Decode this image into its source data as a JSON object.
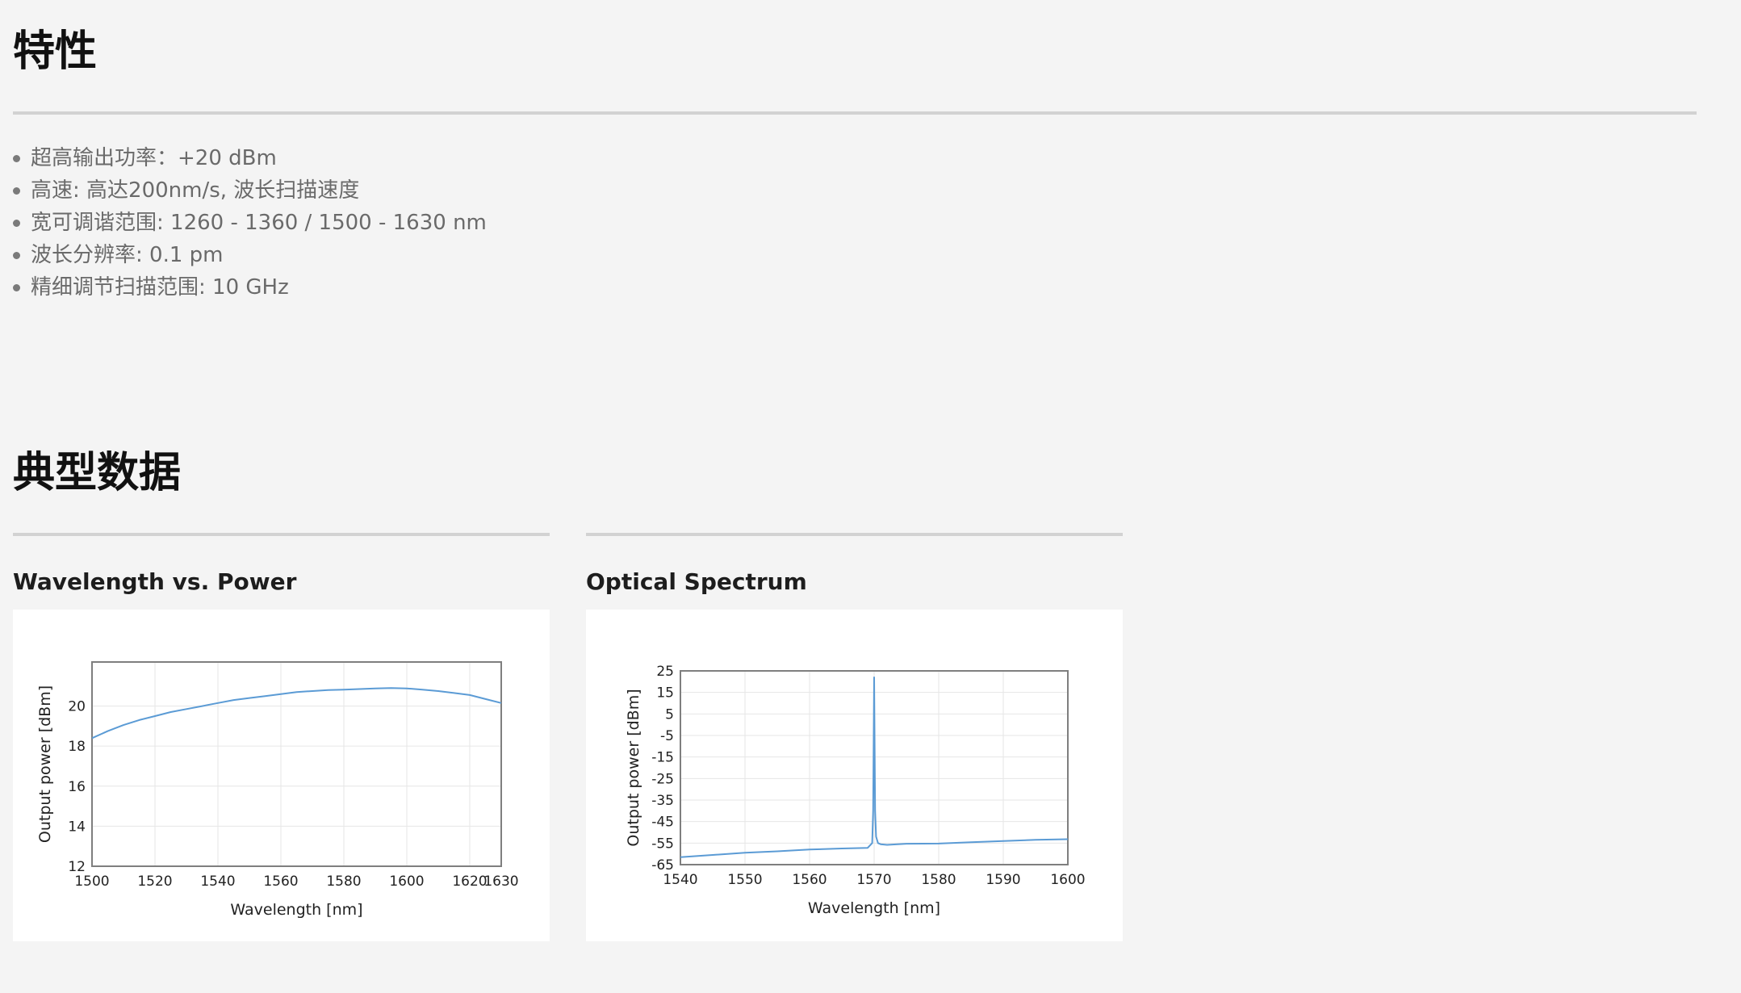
{
  "features": {
    "heading": "特性",
    "items": [
      "超高输出功率：+20 dBm",
      "高速: 高达200nm/s, 波长扫描速度",
      "宽可调谐范围: 1260 - 1360 / 1500 - 1630 nm",
      "波长分辨率: 0.1 pm",
      "精细调节扫描范围: 10 GHz"
    ]
  },
  "typical": {
    "heading": "典型数据",
    "card1_title": "Wavelength vs. Power",
    "card2_title": "Optical Spectrum"
  },
  "colors": {
    "series": "#5b9bd5",
    "axis": "#7f7f7f",
    "grid": "#e6e6e6"
  },
  "chart_data": [
    {
      "type": "line",
      "title": "",
      "xlabel": "Wavelength [nm]",
      "ylabel": "Output power [dBm]",
      "xlim": [
        1500,
        1630
      ],
      "ylim": [
        12,
        22.2
      ],
      "xticks": [
        1500,
        1520,
        1540,
        1560,
        1580,
        1600,
        1620,
        1630
      ],
      "yticks": [
        12,
        14,
        16,
        18,
        20
      ],
      "grid": true,
      "series": [
        {
          "x": [
            1500,
            1505,
            1510,
            1515,
            1520,
            1525,
            1530,
            1535,
            1540,
            1545,
            1550,
            1555,
            1560,
            1565,
            1570,
            1575,
            1580,
            1585,
            1590,
            1595,
            1600,
            1605,
            1610,
            1615,
            1620,
            1625,
            1630
          ],
          "y": [
            18.4,
            18.75,
            19.05,
            19.3,
            19.5,
            19.7,
            19.85,
            20.0,
            20.15,
            20.3,
            20.4,
            20.5,
            20.6,
            20.7,
            20.75,
            20.8,
            20.82,
            20.85,
            20.88,
            20.9,
            20.88,
            20.82,
            20.75,
            20.65,
            20.55,
            20.35,
            20.15
          ]
        }
      ]
    },
    {
      "type": "line",
      "title": "",
      "xlabel": "Wavelength [nm]",
      "ylabel": "Output power [dBm]",
      "xlim": [
        1540,
        1600
      ],
      "ylim": [
        -65,
        25
      ],
      "xticks": [
        1540,
        1550,
        1560,
        1570,
        1580,
        1590,
        1600
      ],
      "yticks": [
        25,
        15,
        5,
        -5,
        -15,
        -25,
        -35,
        -45,
        -55,
        -65
      ],
      "grid": true,
      "series": [
        {
          "x": [
            1540,
            1545,
            1550,
            1555,
            1560,
            1565,
            1569,
            1569.7,
            1569.85,
            1570,
            1570.15,
            1570.3,
            1570.6,
            1571,
            1572,
            1575,
            1580,
            1585,
            1590,
            1595,
            1600
          ],
          "y": [
            -61.5,
            -60.5,
            -59.5,
            -58.8,
            -58.0,
            -57.5,
            -57.2,
            -55,
            -40,
            22,
            -40,
            -52,
            -55,
            -55.5,
            -55.8,
            -55.3,
            -55.2,
            -54.6,
            -54.0,
            -53.5,
            -53.2
          ]
        }
      ]
    }
  ]
}
